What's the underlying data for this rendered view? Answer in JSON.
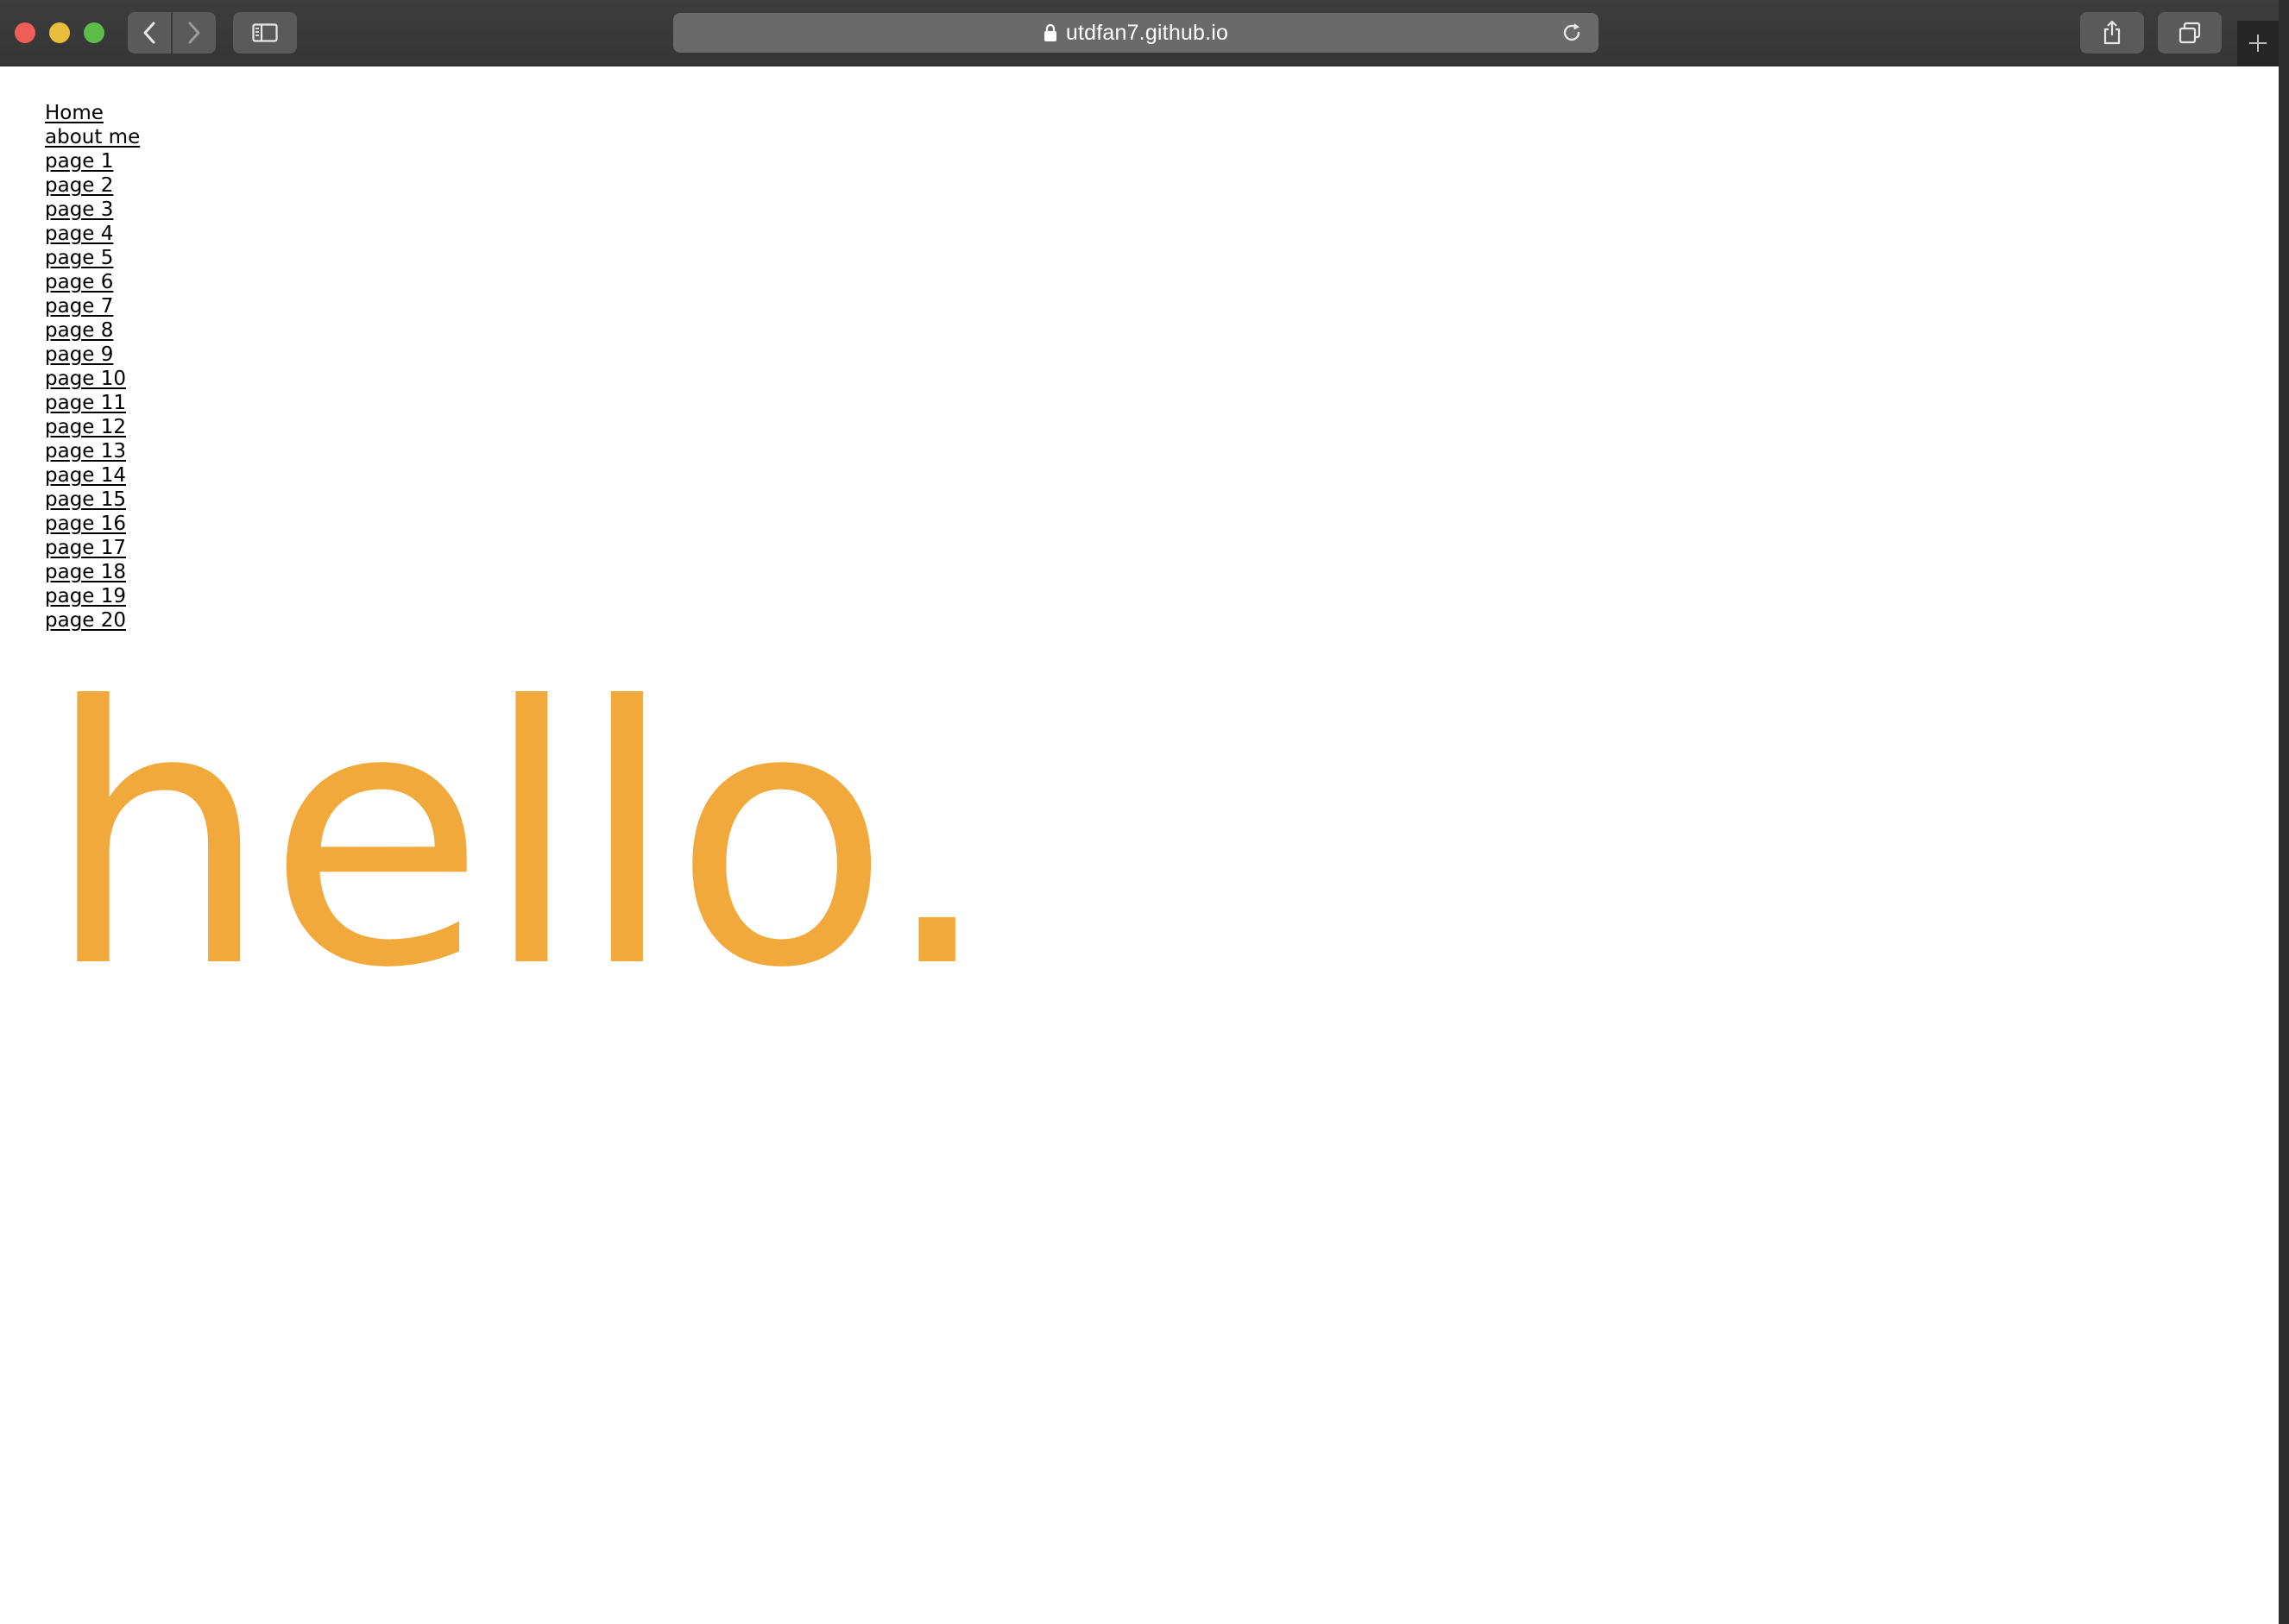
{
  "browser": {
    "url": "utdfan7.github.io",
    "icons": {
      "back": "chevron-left-icon",
      "forward": "chevron-right-icon",
      "sidebar": "sidebar-icon",
      "lock": "lock-icon",
      "reload": "reload-icon",
      "share": "share-icon",
      "tabs": "tabs-overview-icon",
      "new_tab": "plus-icon"
    }
  },
  "page": {
    "nav_links": [
      "Home",
      "about me",
      "page 1",
      "page 2",
      "page 3",
      "page 4",
      "page 5",
      "page 6",
      "page 7",
      "page 8",
      "page 9",
      "page 10",
      "page 11",
      "page 12",
      "page 13",
      "page 14",
      "page 15",
      "page 16",
      "page 17",
      "page 18",
      "page 19",
      "page 20"
    ],
    "hero_text": "hello.",
    "hero_color": "#f2a93b"
  }
}
